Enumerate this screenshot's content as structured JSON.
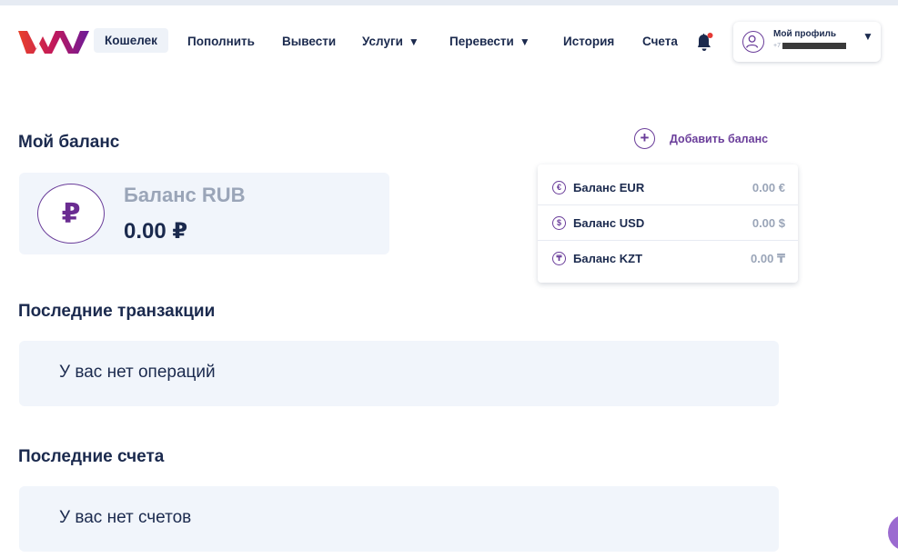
{
  "nav": {
    "links": [
      {
        "label": "Кошелек",
        "active": true
      },
      {
        "label": "Пополнить"
      },
      {
        "label": "Вывести"
      },
      {
        "label": "Услуги",
        "dropdown": true
      },
      {
        "label": "Перевести",
        "dropdown": true
      },
      {
        "label": "История"
      },
      {
        "label": "Счета"
      }
    ],
    "dropdown_caret": "▼"
  },
  "profile": {
    "label": "Мой профиль",
    "phone_prefix": "+7",
    "caret": "▼"
  },
  "balance": {
    "title": "Мой баланс",
    "add_label": "Добавить баланс",
    "add_icon": "+",
    "main": {
      "symbol": "₽",
      "title": "Баланс RUB",
      "amount": "0.00 ₽"
    },
    "currencies": [
      {
        "icon": "€",
        "name": "Баланс EUR",
        "amount": "0.00 €"
      },
      {
        "icon": "$",
        "name": "Баланс USD",
        "amount": "0.00 $"
      },
      {
        "icon": "₸",
        "name": "Баланс KZT",
        "amount": "0.00 ₸"
      }
    ]
  },
  "transactions": {
    "title": "Последние транзакции",
    "empty": "У вас нет операций"
  },
  "invoices": {
    "title": "Последние счета",
    "empty": "У вас нет счетов"
  },
  "colors": {
    "accent": "#6a3d9a",
    "text": "#1b2a4e",
    "muted": "#9aa5b8",
    "card_bg": "#f1f5fb",
    "notification": "#e53935"
  }
}
